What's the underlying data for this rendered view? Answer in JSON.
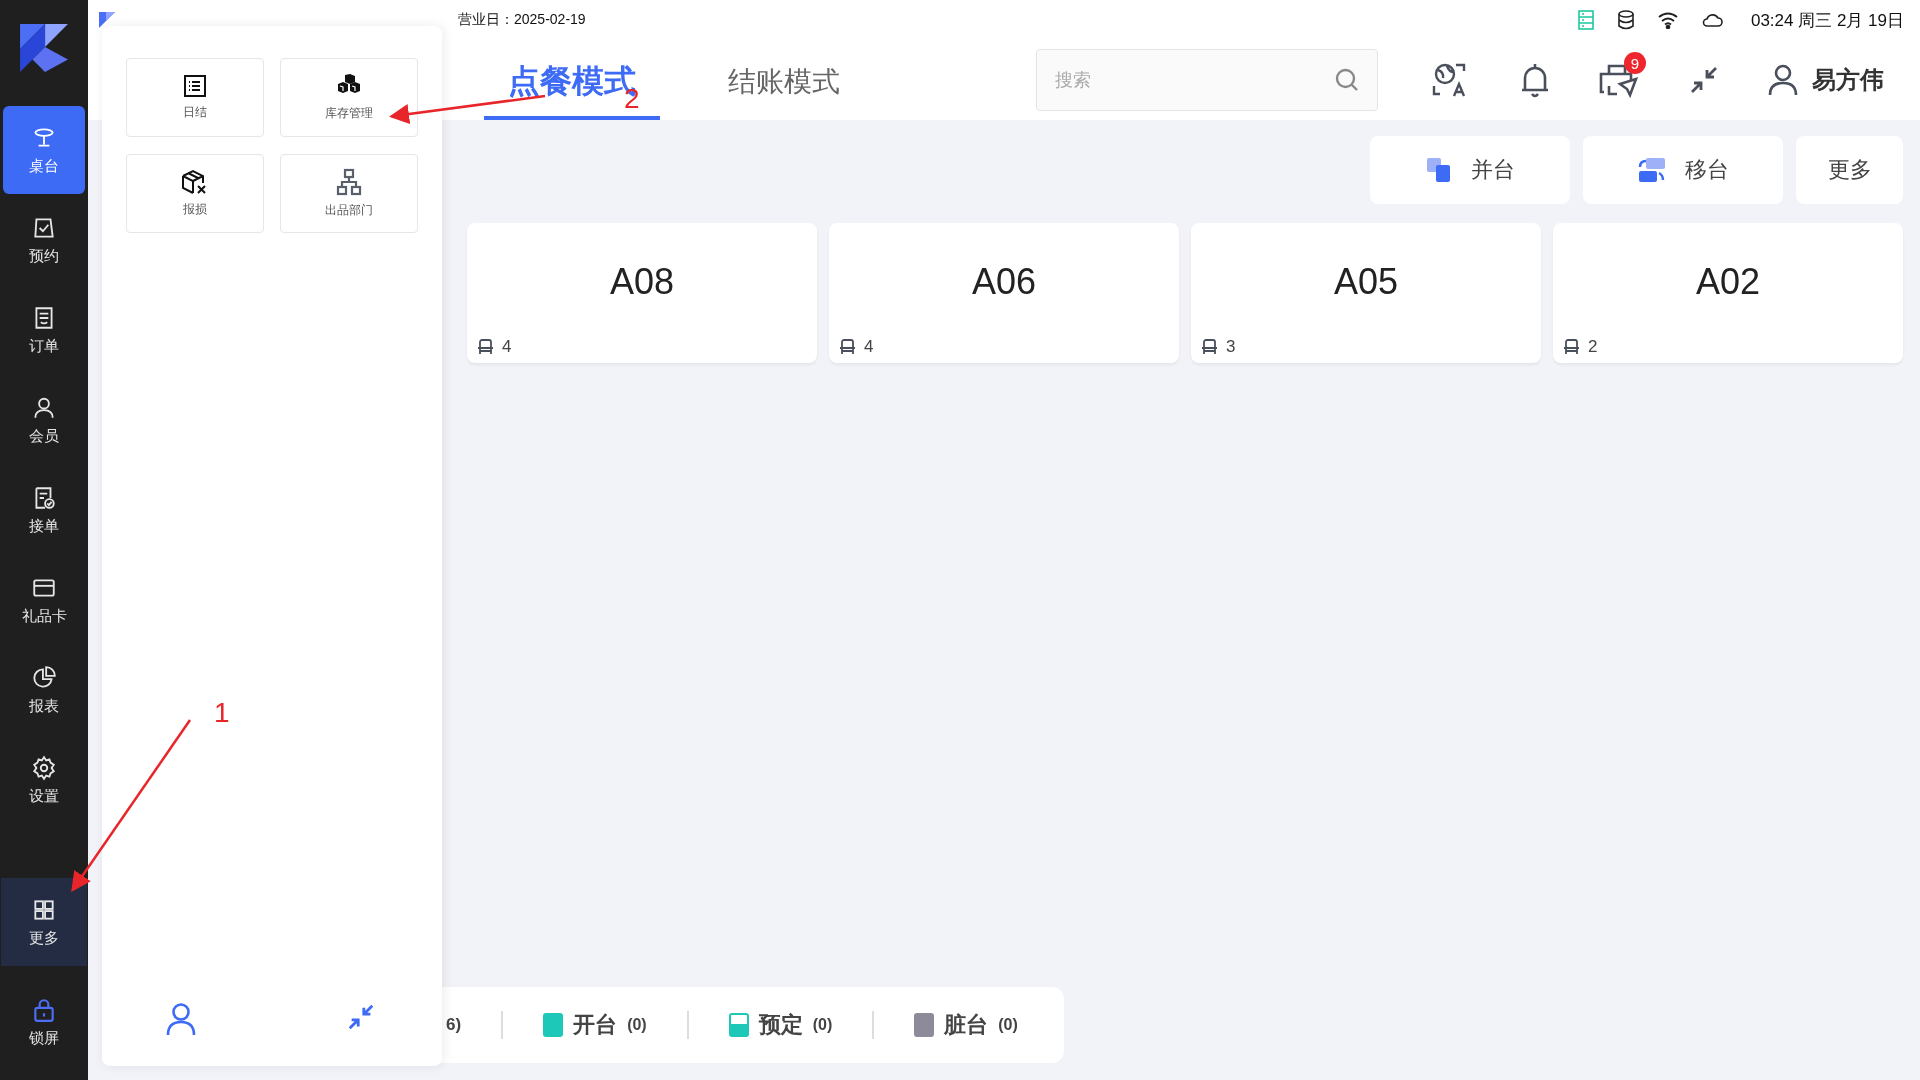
{
  "sidebar": {
    "items": [
      {
        "label": "桌台",
        "selected": true,
        "expanded": false
      },
      {
        "label": "预约",
        "selected": false,
        "expanded": false
      },
      {
        "label": "订单",
        "selected": false,
        "expanded": false
      },
      {
        "label": "会员",
        "selected": false,
        "expanded": false
      },
      {
        "label": "接单",
        "selected": false,
        "expanded": false
      },
      {
        "label": "礼品卡",
        "selected": false,
        "expanded": false
      },
      {
        "label": "报表",
        "selected": false,
        "expanded": false
      },
      {
        "label": "设置",
        "selected": false,
        "expanded": false
      },
      {
        "label": "更多",
        "selected": false,
        "expanded": true
      }
    ],
    "lock_button": {
      "label": "锁屏"
    }
  },
  "status_bar": {
    "business_day": "营业日：2025-02-19",
    "clock": "03:24 周三 2月 19日"
  },
  "tabs": [
    {
      "label": "点餐模式",
      "selected": true
    },
    {
      "label": "结账模式",
      "selected": false
    }
  ],
  "search": {
    "placeholder": "搜索"
  },
  "notifications": {
    "badge": "9"
  },
  "user": {
    "name": "易方伟"
  },
  "toolbar": {
    "buttons": [
      {
        "label": "并台"
      },
      {
        "label": "移台"
      },
      {
        "label": "更多"
      }
    ]
  },
  "tables": [
    {
      "name": "A08",
      "seats": "4"
    },
    {
      "name": "A06",
      "seats": "4"
    },
    {
      "name": "A05",
      "seats": "3"
    },
    {
      "name": "A02",
      "seats": "2"
    }
  ],
  "legend": {
    "partial": "6)",
    "items": [
      {
        "label": "开台",
        "count": "(0)",
        "color": "#1ec8b8",
        "kind": "solid"
      },
      {
        "label": "预定",
        "count": "(0)",
        "color": "#1ec8b8",
        "kind": "half"
      },
      {
        "label": "脏台",
        "count": "(0)",
        "color": "#8d8a99",
        "kind": "solid"
      }
    ]
  },
  "more_menu": {
    "tiles": [
      {
        "label": "日结"
      },
      {
        "label": "库存管理"
      },
      {
        "label": "报损"
      },
      {
        "label": "出品部门"
      }
    ]
  },
  "annotations": [
    {
      "label": "1"
    },
    {
      "label": "2"
    }
  ]
}
